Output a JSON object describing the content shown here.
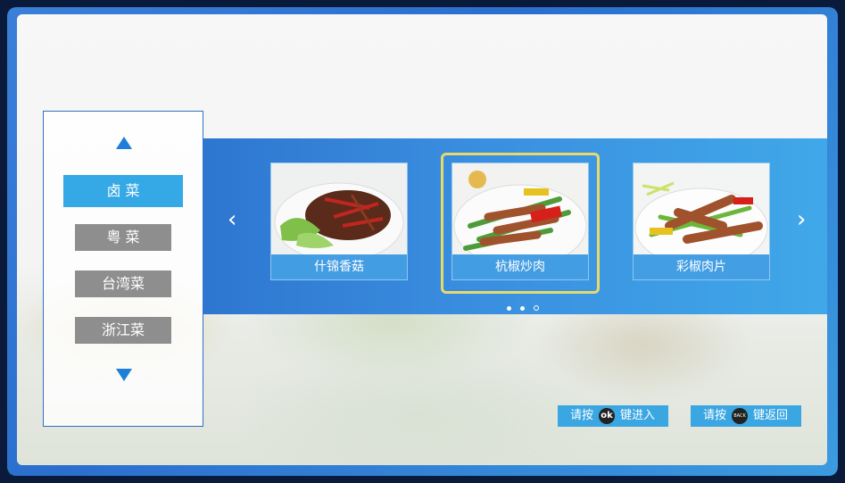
{
  "sidebar": {
    "categories": [
      {
        "label": "卤 菜",
        "active": true
      },
      {
        "label": "粤 菜",
        "active": false
      },
      {
        "label": "台湾菜",
        "active": false
      },
      {
        "label": "浙江菜",
        "active": false
      }
    ],
    "up_icon": "triangle-up-icon",
    "down_icon": "triangle-down-icon"
  },
  "carousel": {
    "prev_icon": "chevron-left-icon",
    "next_icon": "chevron-right-icon",
    "items": [
      {
        "name": "什锦香菇"
      },
      {
        "name": "杭椒炒肉",
        "focused": true
      },
      {
        "name": "彩椒肉片"
      }
    ],
    "pagination": {
      "current": 2,
      "total": 3
    }
  },
  "hints": {
    "enter": {
      "prefix": "请按",
      "key": "ok",
      "suffix": "键进入"
    },
    "back": {
      "prefix": "请按",
      "key": "BACK",
      "suffix": "键返回"
    }
  },
  "colors": {
    "accent": "#34a9e6",
    "focus": "#e9d96a",
    "inactive": "#8e8e8e"
  }
}
